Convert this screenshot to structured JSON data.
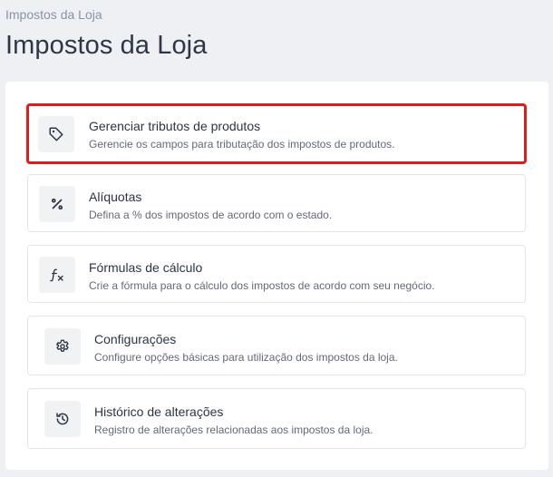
{
  "header": {
    "breadcrumb": "Impostos da Loja",
    "title": "Impostos da Loja"
  },
  "items": [
    {
      "title": "Gerenciar tributos de produtos",
      "description": "Gerencie os campos para tributação dos impostos de produtos.",
      "icon": "tag-icon",
      "highlighted": true
    },
    {
      "title": "Alíquotas",
      "description": "Defina a % dos impostos de acordo com o estado.",
      "icon": "percent-icon"
    },
    {
      "title": "Fórmulas de cálculo",
      "description": "Crie a fórmula para o cálculo dos impostos de acordo com seu negócio.",
      "icon": "function-icon"
    },
    {
      "title": "Configurações",
      "description": "Configure opções básicas para utilização dos impostos da loja.",
      "icon": "gear-icon"
    },
    {
      "title": "Histórico de alterações",
      "description": "Registro de alterações relacionadas aos impostos da loja.",
      "icon": "history-icon"
    }
  ],
  "colors": {
    "highlight_border": "#e01b1b",
    "background": "#eef0f3"
  }
}
